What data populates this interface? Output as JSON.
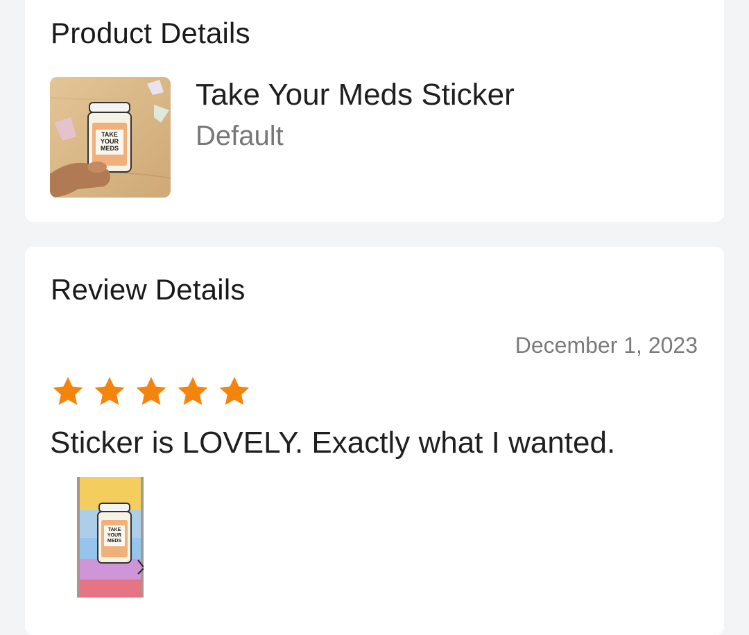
{
  "product_section": {
    "title": "Product Details",
    "product": {
      "name": "Take Your Meds Sticker",
      "variant": "Default",
      "thumbnail_icon": "sticker-photo"
    }
  },
  "review_section": {
    "title": "Review Details",
    "date": "December 1, 2023",
    "rating": 5,
    "rating_max": 5,
    "star_color": "#f5840c",
    "text": "Sticker is LOVELY. Exactly what I wanted.",
    "photo_icon": "review-photo"
  },
  "sticker_label": [
    "TAKE",
    "YOUR",
    "MEDS"
  ]
}
